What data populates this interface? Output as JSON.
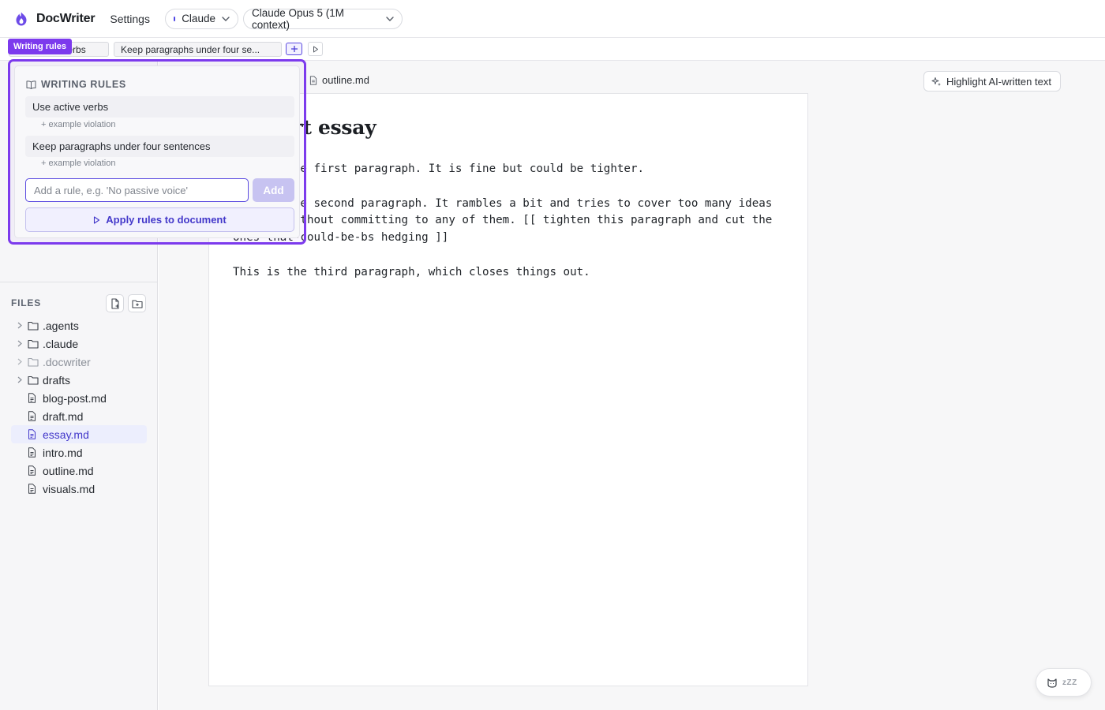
{
  "app": {
    "name": "DocWriter",
    "accent": "#7c3aed",
    "brand": "#4f46e5"
  },
  "topbar": {
    "settings_label": "Settings",
    "provider": "Claude",
    "model": "Claude Opus 5 (1M context)"
  },
  "rule_strip": {
    "chips": [
      "Use active verbs",
      "Keep paragraphs under four se..."
    ]
  },
  "writing_rules": {
    "tag": "Writing rules",
    "heading": "WRITING RULES",
    "rules": [
      {
        "text": "Use active verbs",
        "example_link": "+ example violation"
      },
      {
        "text": "Keep paragraphs under four sentences",
        "example_link": "+ example violation"
      }
    ],
    "input_placeholder": "Add a rule, e.g. 'No passive voice'",
    "add_label": "Add",
    "apply_label": "Apply rules to document"
  },
  "files": {
    "heading": "FILES",
    "items": [
      {
        "name": ".agents",
        "type": "folder"
      },
      {
        "name": ".claude",
        "type": "folder"
      },
      {
        "name": ".docwriter",
        "type": "folder",
        "muted": true
      },
      {
        "name": "drafts",
        "type": "folder"
      },
      {
        "name": "blog-post.md",
        "type": "file"
      },
      {
        "name": "draft.md",
        "type": "file"
      },
      {
        "name": "essay.md",
        "type": "file",
        "active": true
      },
      {
        "name": "intro.md",
        "type": "file"
      },
      {
        "name": "outline.md",
        "type": "file"
      },
      {
        "name": "visuals.md",
        "type": "file"
      }
    ]
  },
  "editor": {
    "open_tab": "outline.md",
    "highlight_label": "Highlight AI-written text",
    "title": "A short essay",
    "paragraphs": [
      "This is the first paragraph. It is fine but could be tighter.",
      "This is the second paragraph. It rambles a bit and tries to cover too many ideas at once without committing to any of them. [[ tighten this paragraph and cut the ones-that-could-be-bs hedging ]]",
      "This is the third paragraph, which closes things out."
    ]
  },
  "mascot": {
    "status": "zZZ",
    "icon": "cat-icon"
  }
}
